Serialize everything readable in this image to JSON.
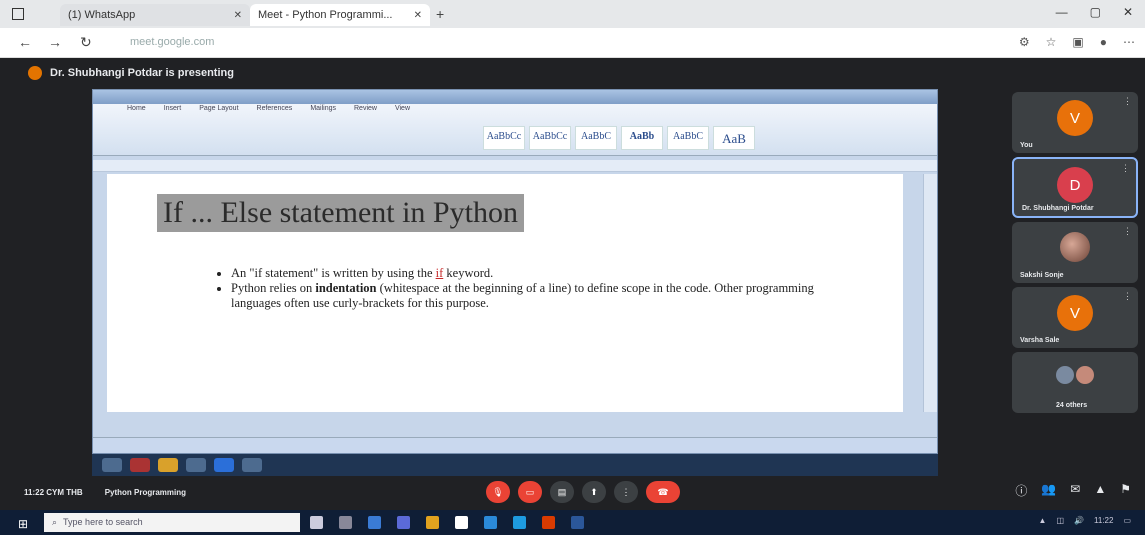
{
  "browser": {
    "tabs": [
      {
        "label": "(1) WhatsApp"
      },
      {
        "label": "Meet - Python Programmi..."
      }
    ],
    "new_tab": "+",
    "url": "meet.google.com",
    "window_controls": [
      "—",
      "▢",
      "✕"
    ]
  },
  "meet": {
    "presenting_text": "Dr. Shubhangi Potdar is presenting",
    "meeting_code": "11:22 CYM THB",
    "meeting_title": "Python Programming",
    "participants": [
      {
        "initial": "V",
        "name": "You",
        "color": "#e8710a"
      },
      {
        "initial": "D",
        "name": "Dr. Shubhangi Potdar",
        "color": "#d93f4d"
      },
      {
        "initial": "",
        "name": "Sakshi Sonje",
        "color": ""
      },
      {
        "initial": "V",
        "name": "Varsha Sale",
        "color": "#e8710a"
      },
      {
        "initial": "",
        "name": "24 others",
        "color": ""
      }
    ]
  },
  "document": {
    "title": "If ... Else statement in Python",
    "bullets": {
      "b1_pre": "An \"if statement\" is written by using the ",
      "b1_kw": "if",
      "b1_post": " keyword.",
      "b2_pre": "Python relies on ",
      "b2_bold": "indentation",
      "b2_post": " (whitespace at the beginning of a line) to define scope in the code. Other programming languages often use curly-brackets for this purpose."
    },
    "styles": [
      "AaBbCc",
      "AaBbCc",
      "AaBbC",
      "AaBb",
      "AaBbC",
      "AaB"
    ]
  },
  "taskbar": {
    "search_placeholder": "Type here to search",
    "time": "11:22"
  }
}
